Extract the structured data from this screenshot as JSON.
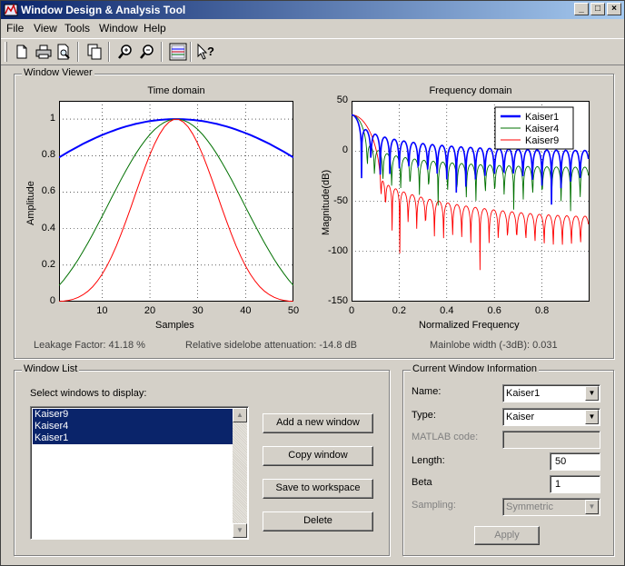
{
  "window": {
    "title": "Window Design & Analysis Tool"
  },
  "titlebar_buttons": {
    "minimize": "_",
    "maximize": "□",
    "close": "×"
  },
  "menu": [
    "File",
    "View",
    "Tools",
    "Window",
    "Help"
  ],
  "toolbar_icons": [
    "new-icon",
    "print-icon",
    "print-preview-icon",
    "copy-window-icon",
    "zoom-in-icon",
    "zoom-out-icon",
    "full-view-icon",
    "whats-this-icon"
  ],
  "viewer": {
    "group_title": "Window Viewer",
    "time_title": "Time domain",
    "freq_title": "Frequency domain",
    "time_xlabel": "Samples",
    "time_ylabel": "Amplitude",
    "freq_xlabel": "Normalized Frequency",
    "freq_ylabel": "Magnitude(dB)",
    "leakage": "Leakage Factor: 41.18 %",
    "sidelobe": "Relative sidelobe attenuation: -14.8 dB",
    "mainlobe": "Mainlobe width (-3dB): 0.031"
  },
  "chart_data": [
    {
      "type": "line",
      "title": "Time domain",
      "xlabel": "Samples",
      "ylabel": "Amplitude",
      "xlim": [
        1,
        50
      ],
      "ylim": [
        0,
        1.1
      ],
      "xticks": [
        "10",
        "20",
        "30",
        "40",
        "50"
      ],
      "yticks": [
        "0",
        "0.2",
        "0.4",
        "0.6",
        "0.8",
        "1"
      ],
      "grid": true,
      "series": [
        {
          "name": "Kaiser1",
          "color": "#0000ff",
          "beta": 1,
          "x": [
            1,
            5,
            10,
            15,
            20,
            25,
            30,
            35,
            40,
            45,
            50
          ],
          "y": [
            0.79,
            0.85,
            0.91,
            0.96,
            0.99,
            1.0,
            0.99,
            0.96,
            0.91,
            0.85,
            0.79
          ]
        },
        {
          "name": "Kaiser4",
          "color": "#007000",
          "beta": 4,
          "x": [
            1,
            5,
            10,
            15,
            20,
            25,
            30,
            35,
            40,
            45,
            50
          ],
          "y": [
            0.09,
            0.24,
            0.49,
            0.75,
            0.94,
            1.0,
            0.95,
            0.76,
            0.5,
            0.25,
            0.09
          ]
        },
        {
          "name": "Kaiser9",
          "color": "#ff0000",
          "beta": 9,
          "x": [
            1,
            5,
            10,
            15,
            20,
            25,
            30,
            35,
            40,
            45,
            50
          ],
          "y": [
            0.0,
            0.02,
            0.13,
            0.42,
            0.82,
            1.0,
            0.84,
            0.44,
            0.14,
            0.03,
            0.0
          ]
        }
      ]
    },
    {
      "type": "line",
      "title": "Frequency domain",
      "xlabel": "Normalized Frequency",
      "ylabel": "Magnitude(dB)",
      "xlim": [
        0,
        1
      ],
      "ylim": [
        -150,
        50
      ],
      "xticks": [
        "0",
        "0.2",
        "0.4",
        "0.6",
        "0.8"
      ],
      "yticks": [
        "50",
        "0",
        "-50",
        "-100",
        "-150"
      ],
      "grid": true,
      "legend": "top-right",
      "series": [
        {
          "name": "Kaiser1",
          "color": "#0000ff",
          "x": [
            0,
            0.05,
            0.2,
            0.4,
            0.6,
            0.8,
            0.98
          ],
          "y": [
            36,
            10,
            -2,
            -12,
            -20,
            -27,
            -35
          ]
        },
        {
          "name": "Kaiser4",
          "color": "#007000",
          "x": [
            0,
            0.05,
            0.1,
            0.2,
            0.4,
            0.6,
            0.8,
            0.98
          ],
          "y": [
            35,
            5,
            -15,
            -20,
            -30,
            -38,
            -45,
            -55
          ]
        },
        {
          "name": "Kaiser9",
          "color": "#ff0000",
          "x": [
            0,
            0.05,
            0.1,
            0.2,
            0.4,
            0.6,
            0.8,
            0.98
          ],
          "y": [
            34,
            0,
            -40,
            -55,
            -70,
            -82,
            -95,
            -110
          ]
        }
      ]
    }
  ],
  "window_list": {
    "group_title": "Window List",
    "prompt": "Select windows to display:",
    "items": [
      "Kaiser9",
      "Kaiser4",
      "Kaiser1"
    ],
    "buttons": {
      "add": "Add a new window",
      "copy": "Copy window",
      "save": "Save to workspace",
      "delete": "Delete"
    }
  },
  "info": {
    "group_title": "Current Window Information",
    "name_label": "Name:",
    "name_value": "Kaiser1",
    "type_label": "Type:",
    "type_value": "Kaiser",
    "matlab_label": "MATLAB code:",
    "matlab_value": "",
    "length_label": "Length:",
    "length_value": "50",
    "beta_label": "Beta",
    "beta_value": "1",
    "sampling_label": "Sampling:",
    "sampling_value": "Symmetric",
    "apply": "Apply"
  }
}
